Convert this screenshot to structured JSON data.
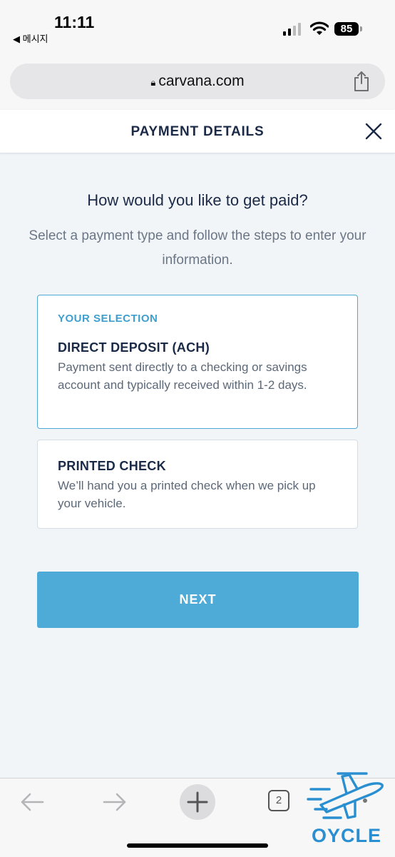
{
  "status_bar": {
    "time": "11:11",
    "back_app_label": "◀ 메시지",
    "battery_level": "85"
  },
  "browser": {
    "url": "carvana.com",
    "open_tabs_count": "2"
  },
  "header": {
    "title": "PAYMENT DETAILS"
  },
  "main": {
    "question": "How would you like to get paid?",
    "subtitle": "Select a payment type and follow the steps to enter your information.",
    "options": [
      {
        "selected_label": "YOUR SELECTION",
        "title": "DIRECT DEPOSIT (ACH)",
        "description": "Payment sent directly to a checking or savings account and typically received within 1-2 days.",
        "selected": true
      },
      {
        "title": "PRINTED CHECK",
        "description": "We’ll hand you a printed check when we pick up your vehicle.",
        "selected": false
      }
    ],
    "next_label": "NEXT"
  },
  "watermark": {
    "text": "OYCLE"
  },
  "colors": {
    "accent": "#4eaad6",
    "navy": "#1b2a47",
    "background": "#f2f5f8"
  }
}
